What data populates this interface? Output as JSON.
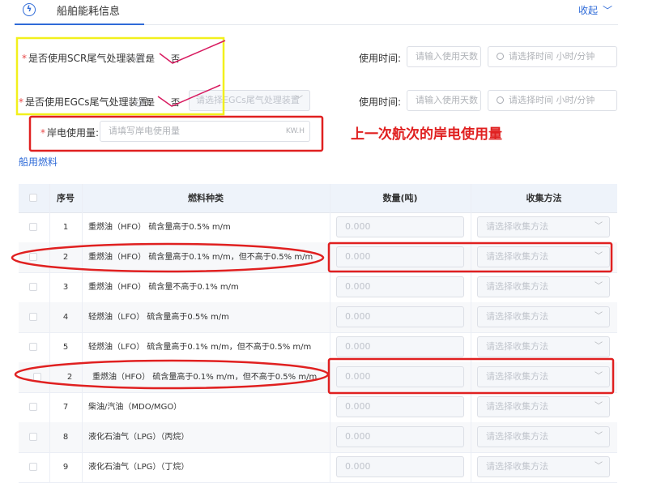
{
  "header": {
    "tab_title": "船舶能耗信息",
    "tab_icon": "lightning-icon",
    "collapse_label": "收起",
    "collapse_icon": "chevron-down-icon"
  },
  "form": {
    "scr": {
      "label": "是否使用SCR尾气处理装置:",
      "option_yes": "是",
      "option_no": "否",
      "time_label": "使用时间:",
      "days_placeholder": "请输入使用天数",
      "time_placeholder": "请选择时间 小时/分钟"
    },
    "egcs": {
      "label": "是否使用EGCs尾气处理装置:",
      "option_yes": "是",
      "option_no": "否",
      "select_placeholder": "请选择EGCs尾气处理装置",
      "time_label": "使用时间:",
      "days_placeholder": "请输入使用天数",
      "time_placeholder": "请选择时间 小时/分钟"
    },
    "shore_power": {
      "label": "岸电使用量:",
      "placeholder": "请填写岸电使用量",
      "unit": "KW.H"
    }
  },
  "annotation": {
    "text": "上一次航次的岸电使用量",
    "color": "#e02020"
  },
  "section": {
    "title": "船用燃料"
  },
  "table": {
    "headers": {
      "seq": "序号",
      "fuel_type": "燃料种类",
      "quantity": "数量(吨)",
      "method": "收集方法"
    },
    "qty_placeholder": "0.000",
    "method_placeholder": "请选择收集方法",
    "rows": [
      {
        "seq": "1",
        "fuel": "重燃油（HFO） 硫含量高于0.5% m/m"
      },
      {
        "seq": "2",
        "fuel": "重燃油（HFO） 硫含量高于0.1% m/m，但不高于0.5% m/m"
      },
      {
        "seq": "3",
        "fuel": "重燃油（HFO） 硫含量不高于0.1% m/m"
      },
      {
        "seq": "4",
        "fuel": "轻燃油（LFO） 硫含量高于0.5% m/m"
      },
      {
        "seq": "5",
        "fuel": "轻燃油（LFO） 硫含量高于0.1% m/m，但不高于0.5% m/m"
      },
      {
        "seq": "2",
        "fuel": "重燃油（HFO） 硫含量高于0.1% m/m，但不高于0.5% m/m"
      },
      {
        "seq": "7",
        "fuel": "柴油/汽油（MDO/MGO）"
      },
      {
        "seq": "8",
        "fuel": "液化石油气（LPG）（丙烷）"
      },
      {
        "seq": "9",
        "fuel": "液化石油气（LPG）（丁烷）"
      }
    ]
  },
  "colors": {
    "accent": "#2f6bd8",
    "required": "#e84a4a",
    "highlight_yellow": "#f2f01c",
    "highlight_red": "#e02020"
  }
}
